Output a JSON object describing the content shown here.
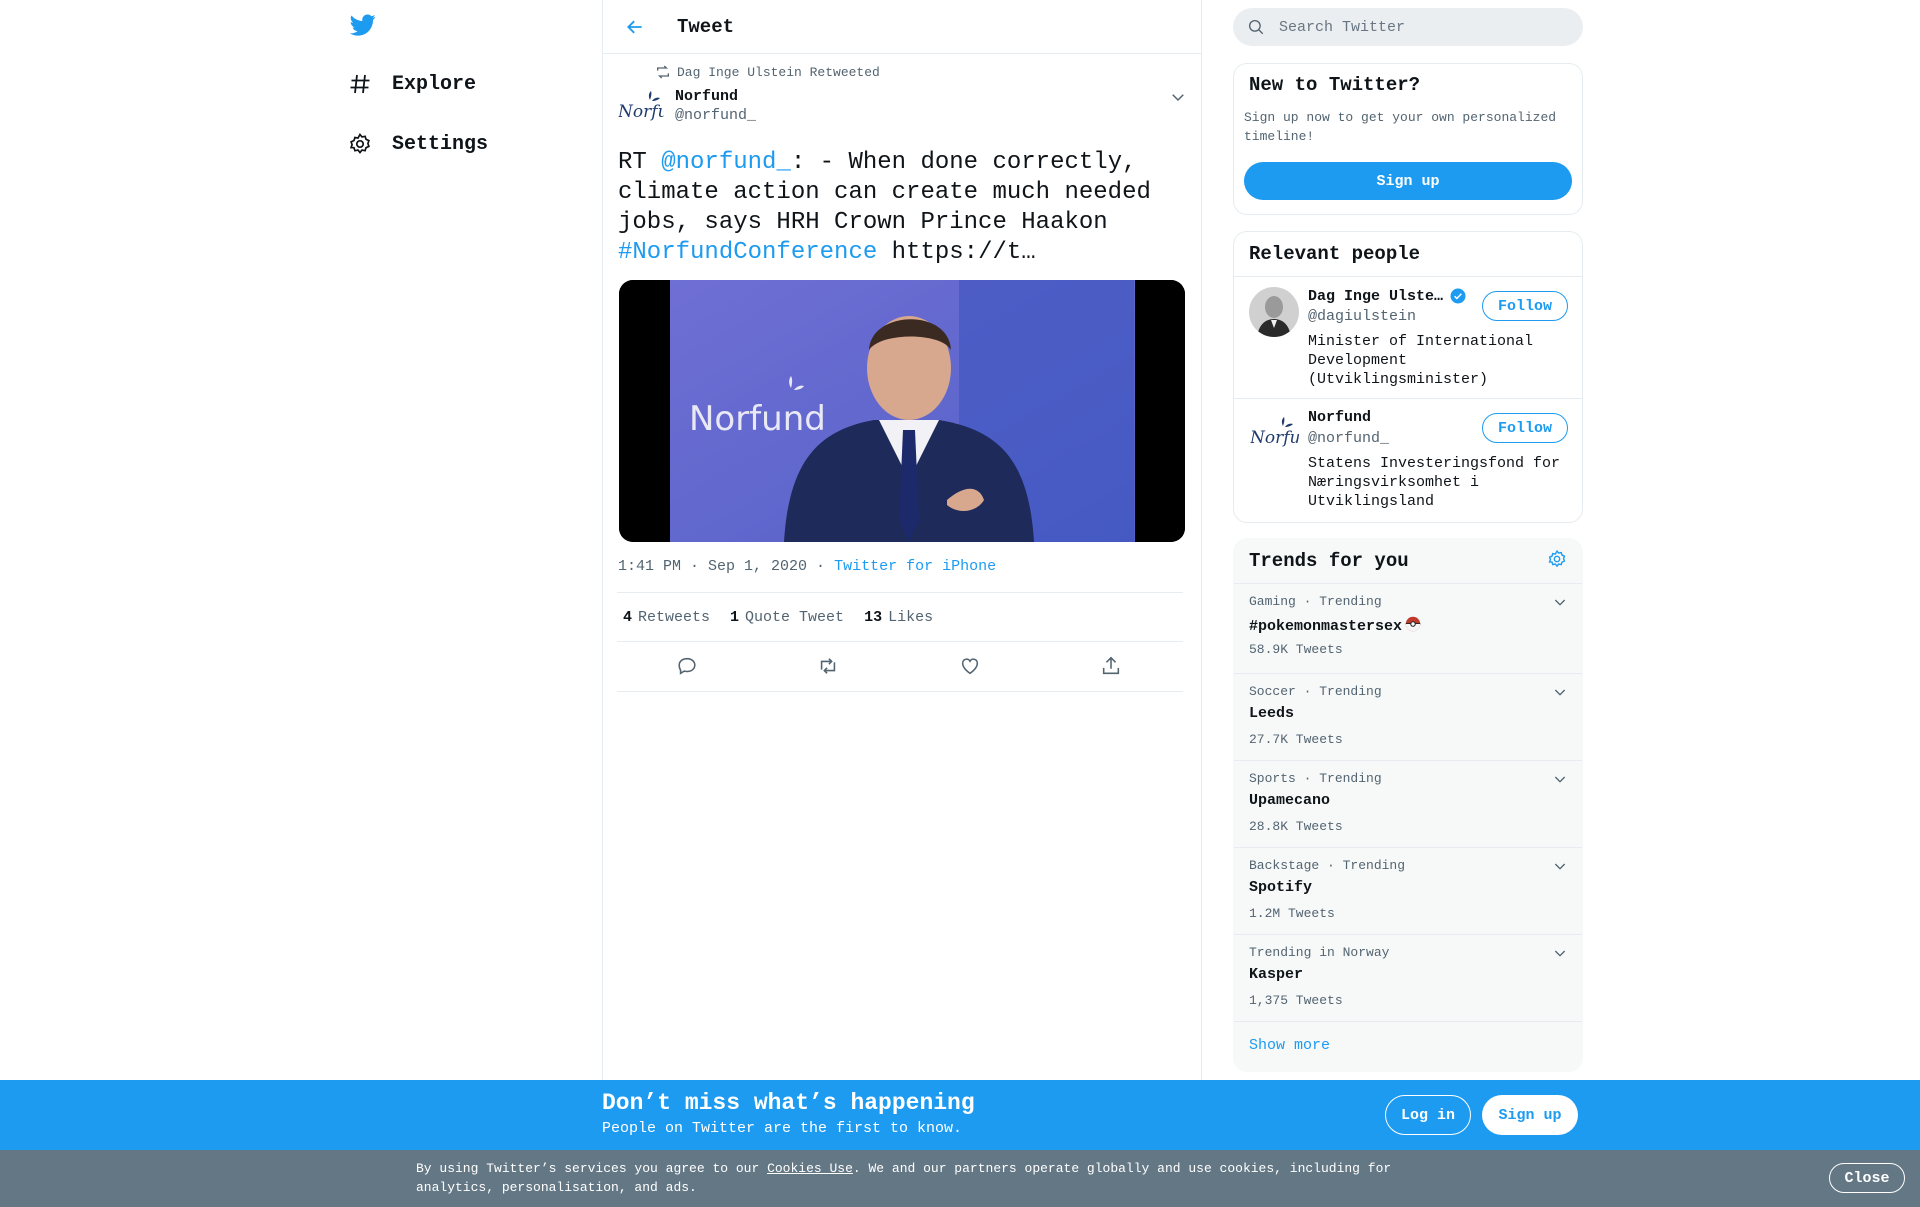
{
  "nav": {
    "logo_icon": "twitter-bird-icon",
    "items": [
      {
        "label": "Explore",
        "icon": "hashtag-icon"
      },
      {
        "label": "Settings",
        "icon": "gear-icon"
      }
    ]
  },
  "main": {
    "header_title": "Tweet",
    "retweet_note": "Dag Inge Ulstein Retweeted",
    "author": {
      "name": "Norfund",
      "handle": "@norfund_"
    },
    "tweet": {
      "prefix": "RT ",
      "mention": "@norfund_",
      "body": ": - When done correctly, climate action can create much needed jobs, says HRH Crown Prince Haakon ",
      "hashtag": "#NorfundConference",
      "link": " https://t…"
    },
    "media_logo_text": "Norfund",
    "timestamp": "1:41 PM · Sep 1, 2020",
    "dot": "·",
    "source": "Twitter for iPhone",
    "stats": [
      {
        "num": "4",
        "label": "Retweets"
      },
      {
        "num": "1",
        "label": "Quote Tweet"
      },
      {
        "num": "13",
        "label": "Likes"
      }
    ]
  },
  "sidebar": {
    "search_placeholder": "Search Twitter",
    "new_to_twitter": {
      "title": "New to Twitter?",
      "desc": "Sign up now to get your own personalized timeline!",
      "button": "Sign up"
    },
    "relevant_people": {
      "title": "Relevant people",
      "people": [
        {
          "name": "Dag Inge Ulste…",
          "handle": "@dagiulstein",
          "bio": "Minister of International Development (Utviklingsminister)",
          "follow": "Follow"
        },
        {
          "name": "Norfund",
          "handle": "@norfund_",
          "bio": "Statens Investeringsfond for Næringsvirksomhet i Utviklingsland",
          "follow": "Follow"
        }
      ]
    },
    "trends": {
      "title": "Trends for you",
      "items": [
        {
          "category": "Gaming · Trending",
          "name": "#pokemonmastersex",
          "count": "58.9K Tweets"
        },
        {
          "category": "Soccer · Trending",
          "name": "Leeds",
          "count": "27.7K Tweets"
        },
        {
          "category": "Sports · Trending",
          "name": "Upamecano",
          "count": "28.8K Tweets"
        },
        {
          "category": "Backstage · Trending",
          "name": "Spotify",
          "count": "1.2M Tweets"
        },
        {
          "category": "Trending in Norway",
          "name": "Kasper",
          "count": "1,375 Tweets"
        }
      ],
      "show_more": "Show more"
    }
  },
  "banner": {
    "title": "Don’t miss what’s happening",
    "subtitle": "People on Twitter are the first to know.",
    "login": "Log in",
    "signup": "Sign up"
  },
  "cookie": {
    "text_before": "By using Twitter’s services you agree to our ",
    "link": "Cookies Use",
    "text_after": ". We and our partners operate globally and use cookies, including for analytics, personalisation, and ads.",
    "close": "Close"
  },
  "colors": {
    "accent": "#1d9bf0",
    "cookie_bg": "#647785"
  }
}
